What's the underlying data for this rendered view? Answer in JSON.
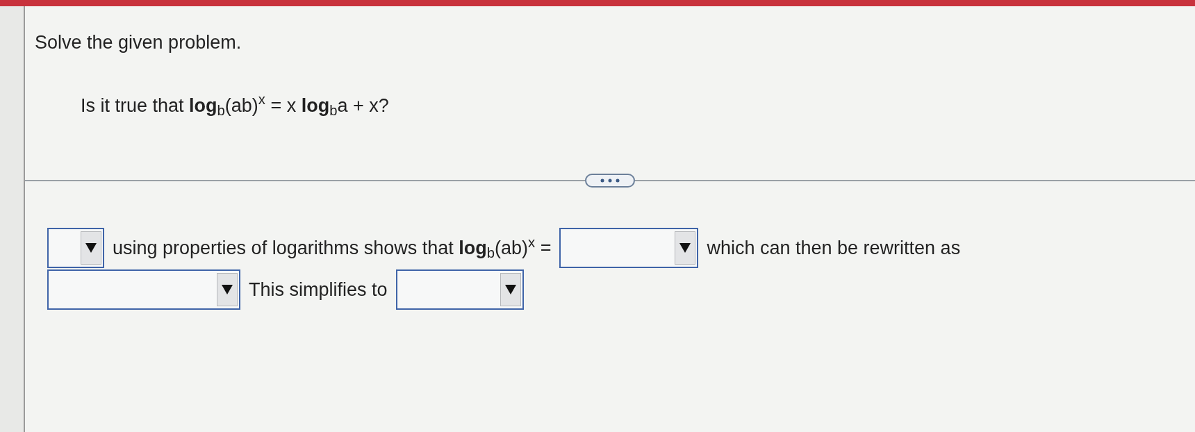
{
  "instruction": "Solve the given problem.",
  "question": "Is it true that **log**$_{b}$(ab)$^{x}$ = x **log**$_{b}$a + x?",
  "answer_lines": [
    [
      {
        "kind": "dropdown"
      },
      {
        "kind": "text",
        "text": "using properties of logarithms shows that **log**$_{b}$(ab)$^{x}$ ="
      },
      {
        "kind": "dropdown"
      },
      {
        "kind": "text",
        "text": "which can then be rewritten as"
      }
    ],
    [
      {
        "kind": "dropdown"
      },
      {
        "kind": "text",
        "text": "This simplifies to"
      },
      {
        "kind": "dropdown"
      }
    ]
  ]
}
